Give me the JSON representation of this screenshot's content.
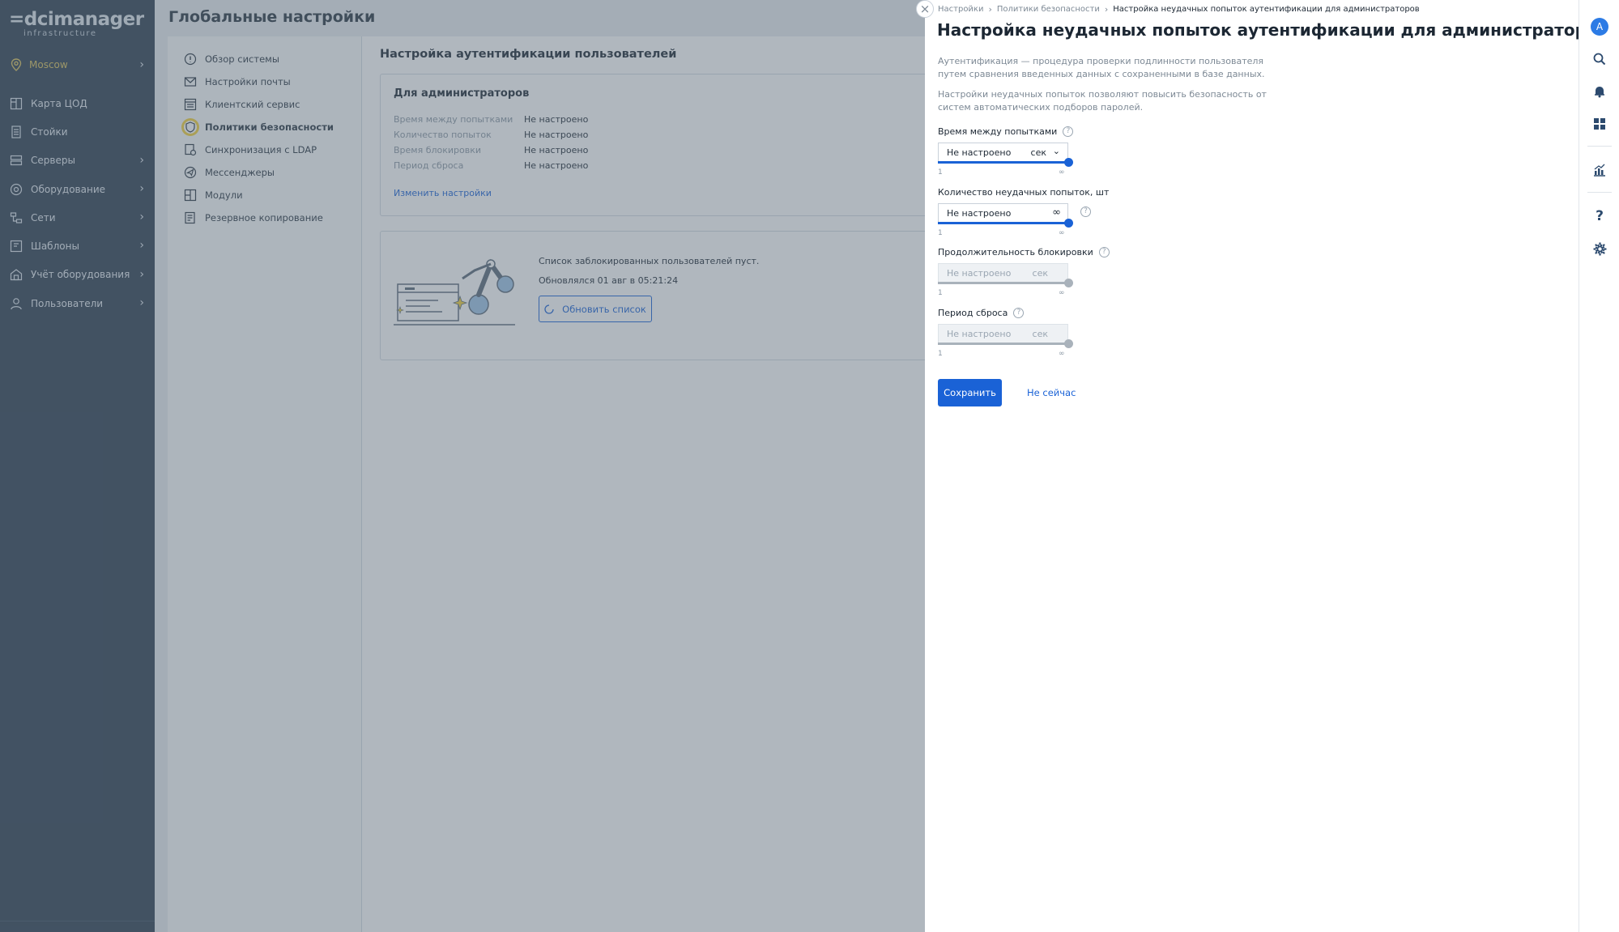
{
  "app": {
    "logo_main": "dcimanager",
    "logo_sub": "infrastructure",
    "location": "Moscow"
  },
  "sidebar": {
    "items": [
      {
        "label": "Карта ЦОД",
        "icon": "datacenter-map-icon"
      },
      {
        "label": "Стойки",
        "icon": "rack-icon"
      },
      {
        "label": "Серверы",
        "icon": "server-icon"
      },
      {
        "label": "Оборудование",
        "icon": "equipment-icon"
      },
      {
        "label": "Сети",
        "icon": "network-icon"
      },
      {
        "label": "Шаблоны",
        "icon": "template-icon"
      },
      {
        "label": "Учёт оборудования",
        "icon": "inventory-icon"
      },
      {
        "label": "Пользователи",
        "icon": "user-icon"
      }
    ]
  },
  "page": {
    "title": "Глобальные настройки"
  },
  "settings_nav": {
    "items": [
      {
        "label": "Обзор системы",
        "icon": "info-icon"
      },
      {
        "label": "Настройки почты",
        "icon": "mail-icon"
      },
      {
        "label": "Клиентский сервис",
        "icon": "client-service-icon"
      },
      {
        "label": "Политики безопасности",
        "icon": "shield-icon",
        "active": true
      },
      {
        "label": "Синхронизация с LDAP",
        "icon": "ldap-sync-icon"
      },
      {
        "label": "Мессенджеры",
        "icon": "messenger-icon"
      },
      {
        "label": "Модули",
        "icon": "modules-icon"
      },
      {
        "label": "Резервное копирование",
        "icon": "backup-icon"
      }
    ]
  },
  "auth": {
    "section_title": "Настройка аутентификации пользователей",
    "card_title": "Для администраторов",
    "rows": [
      {
        "key": "Время между попытками",
        "value": "Не настроено"
      },
      {
        "key": "Количество попыток",
        "value": "Не настроено"
      },
      {
        "key": "Время блокировки",
        "value": "Не настроено"
      },
      {
        "key": "Период сброса",
        "value": "Не настроено"
      }
    ],
    "edit_link": "Изменить настройки",
    "blocked_empty": "Список заблокированных пользователей пуст.",
    "updated": "Обновлялся 01 авг в 05:21:24",
    "refresh_button": "Обновить список"
  },
  "drawer": {
    "breadcrumbs": [
      "Настройки",
      "Политики безопасности",
      "Настройка неудачных попыток аутентификации для администраторов"
    ],
    "title": "Настройка неудачных попыток аутентификации для администраторов",
    "desc1": "Аутентификация — процедура проверки подлинности пользователя путем сравнения введенных данных с сохраненными в базе данных.",
    "desc2": "Настройки неудачных попыток позволяют повысить безопасность от систем автоматических подборов паролей.",
    "fields": [
      {
        "label": "Время между попытками",
        "value": "Не настроено",
        "unit": "сек",
        "min": "1",
        "max": "∞",
        "slider_value": 1.0
      },
      {
        "label": "Количество неудачных попыток, шт",
        "value": "Не настроено",
        "unit": "∞",
        "min": "1",
        "max": "∞",
        "slider_value": 1.0
      },
      {
        "label": "Продолжительность блокировки",
        "value": "Не настроено",
        "unit": "сек",
        "min": "1",
        "max": "∞",
        "slider_value": 1.0
      },
      {
        "label": "Период сброса",
        "value": "Не настроено",
        "unit": "сек",
        "min": "1",
        "max": "∞",
        "slider_value": 1.0
      }
    ],
    "save_button": "Сохранить",
    "cancel_link": "Не сейчас"
  },
  "rail": {
    "avatar_letter": "A",
    "help_symbol": "?"
  },
  "colors": {
    "sidebar_bg": "#2c3e50",
    "accent": "#1a62d6",
    "location": "#d8c05a",
    "active_highlight": "#f4d23b"
  }
}
